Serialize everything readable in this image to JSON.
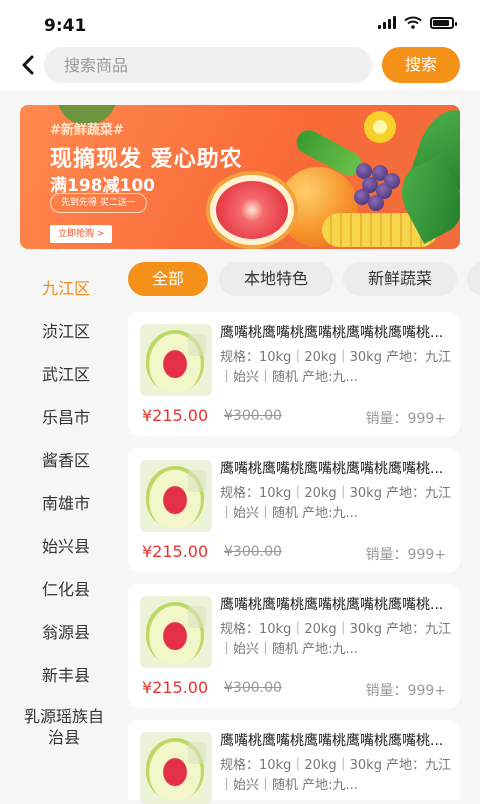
{
  "status": {
    "time": "9:41"
  },
  "header": {
    "search_placeholder": "搜索商品",
    "search_button": "搜索"
  },
  "banner": {
    "tag": "#新鲜蔬菜#",
    "headline": "现摘现发 爱心助农",
    "promo": "满198减100",
    "pill": "先到先得 买二送一",
    "cta": "立即抢购 >"
  },
  "sidebar": {
    "active": "九江区",
    "items": [
      "九江区",
      "浈江区",
      "武江区",
      "乐昌市",
      "酱香区",
      "南雄市",
      "始兴县",
      "仁化县",
      "翁源县",
      "新丰县",
      "乳源瑶族自治县"
    ]
  },
  "chips": {
    "active": "全部",
    "items": [
      "全部",
      "本地特色",
      "新鲜蔬菜"
    ]
  },
  "products": [
    {
      "title": "鹰嘴桃鹰嘴桃鹰嘴桃鹰嘴桃鹰嘴桃...",
      "spec": "规格：10kg｜20kg｜30kg 产地：九江｜始兴｜随机 产地:九...",
      "price": "¥215.00",
      "original_price": "¥300.00",
      "sales": "销量：999+"
    },
    {
      "title": "鹰嘴桃鹰嘴桃鹰嘴桃鹰嘴桃鹰嘴桃...",
      "spec": "规格：10kg｜20kg｜30kg 产地：九江｜始兴｜随机 产地:九...",
      "price": "¥215.00",
      "original_price": "¥300.00",
      "sales": "销量：999+"
    },
    {
      "title": "鹰嘴桃鹰嘴桃鹰嘴桃鹰嘴桃鹰嘴桃...",
      "spec": "规格：10kg｜20kg｜30kg 产地：九江｜始兴｜随机 产地:九...",
      "price": "¥215.00",
      "original_price": "¥300.00",
      "sales": "销量：999+"
    },
    {
      "title": "鹰嘴桃鹰嘴桃鹰嘴桃鹰嘴桃鹰嘴桃...",
      "spec": "规格：10kg｜20kg｜30kg 产地：九江｜始兴｜随机 产地:九...",
      "price": "",
      "original_price": "",
      "sales": ""
    }
  ],
  "colors": {
    "accent": "#f39119",
    "price": "#e8332e",
    "active_text": "#ef8a1c"
  }
}
